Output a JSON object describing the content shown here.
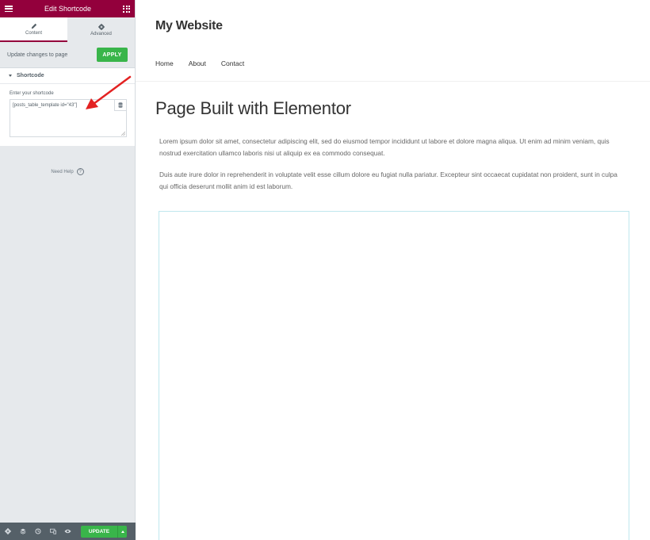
{
  "panel": {
    "header_title": "Edit Shortcode",
    "tabs": [
      {
        "label": "Content",
        "icon": "pencil-icon",
        "active": true
      },
      {
        "label": "Advanced",
        "icon": "gear-icon",
        "active": false
      }
    ],
    "update_row": {
      "label": "Update changes to page",
      "apply_label": "APPLY"
    },
    "section": {
      "title": "Shortcode",
      "field_label": "Enter your shortcode",
      "shortcode_value": "[posts_table_template id=\"43\"]"
    },
    "need_help": "Need Help",
    "footer": {
      "icons": [
        "settings-icon",
        "layers-icon",
        "history-icon",
        "responsive-icon",
        "preview-eye-icon"
      ],
      "update_label": "UPDATE"
    }
  },
  "site": {
    "title": "My Website",
    "nav": [
      "Home",
      "About",
      "Contact"
    ],
    "page_title": "Page Built with Elementor",
    "paragraphs": [
      "Lorem ipsum dolor sit amet, consectetur adipiscing elit, sed do eiusmod tempor incididunt ut labore et dolore magna aliqua. Ut enim ad minim veniam, quis nostrud exercitation ullamco laboris nisi ut aliquip ex ea commodo consequat.",
      "Duis aute irure dolor in reprehenderit in voluptate velit esse cillum dolore eu fugiat nulla pariatur. Excepteur sint occaecat cupidatat non proident, sunt in culpa qui officia deserunt mollit anim id est laborum."
    ]
  },
  "colors": {
    "brand": "#93003c",
    "apply_green": "#39b54a",
    "panel_bg": "#e6e9ec",
    "footer_bg": "#556068",
    "annotation_arrow": "#e32222",
    "widget_outline": "#bfe7ee"
  }
}
